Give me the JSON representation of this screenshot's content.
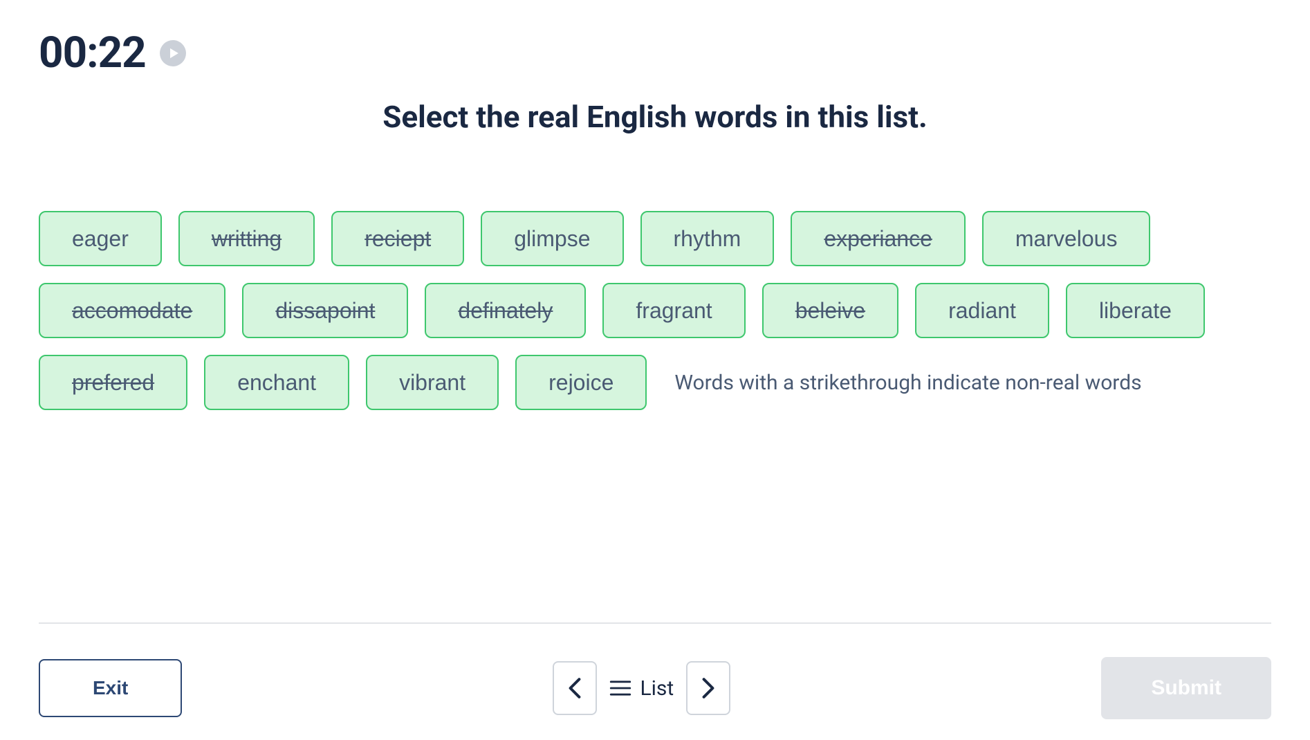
{
  "timer": "00:22",
  "instruction": "Select the real English words in this list.",
  "words": [
    {
      "label": "eager",
      "struck": false
    },
    {
      "label": "writting",
      "struck": true
    },
    {
      "label": "reciept",
      "struck": true
    },
    {
      "label": "glimpse",
      "struck": false
    },
    {
      "label": "rhythm",
      "struck": false
    },
    {
      "label": "experiance",
      "struck": true
    },
    {
      "label": "marvelous",
      "struck": false
    },
    {
      "label": "accomodate",
      "struck": true
    },
    {
      "label": "dissapoint",
      "struck": true
    },
    {
      "label": "definately",
      "struck": true
    },
    {
      "label": "fragrant",
      "struck": false
    },
    {
      "label": "beleive",
      "struck": true
    },
    {
      "label": "radiant",
      "struck": false
    },
    {
      "label": "liberate",
      "struck": false
    },
    {
      "label": "prefered",
      "struck": true
    },
    {
      "label": "enchant",
      "struck": false
    },
    {
      "label": "vibrant",
      "struck": false
    },
    {
      "label": "rejoice",
      "struck": false
    }
  ],
  "hint": "Words with a strikethrough indicate non-real words",
  "footer": {
    "exit": "Exit",
    "list": "List",
    "submit": "Submit"
  }
}
